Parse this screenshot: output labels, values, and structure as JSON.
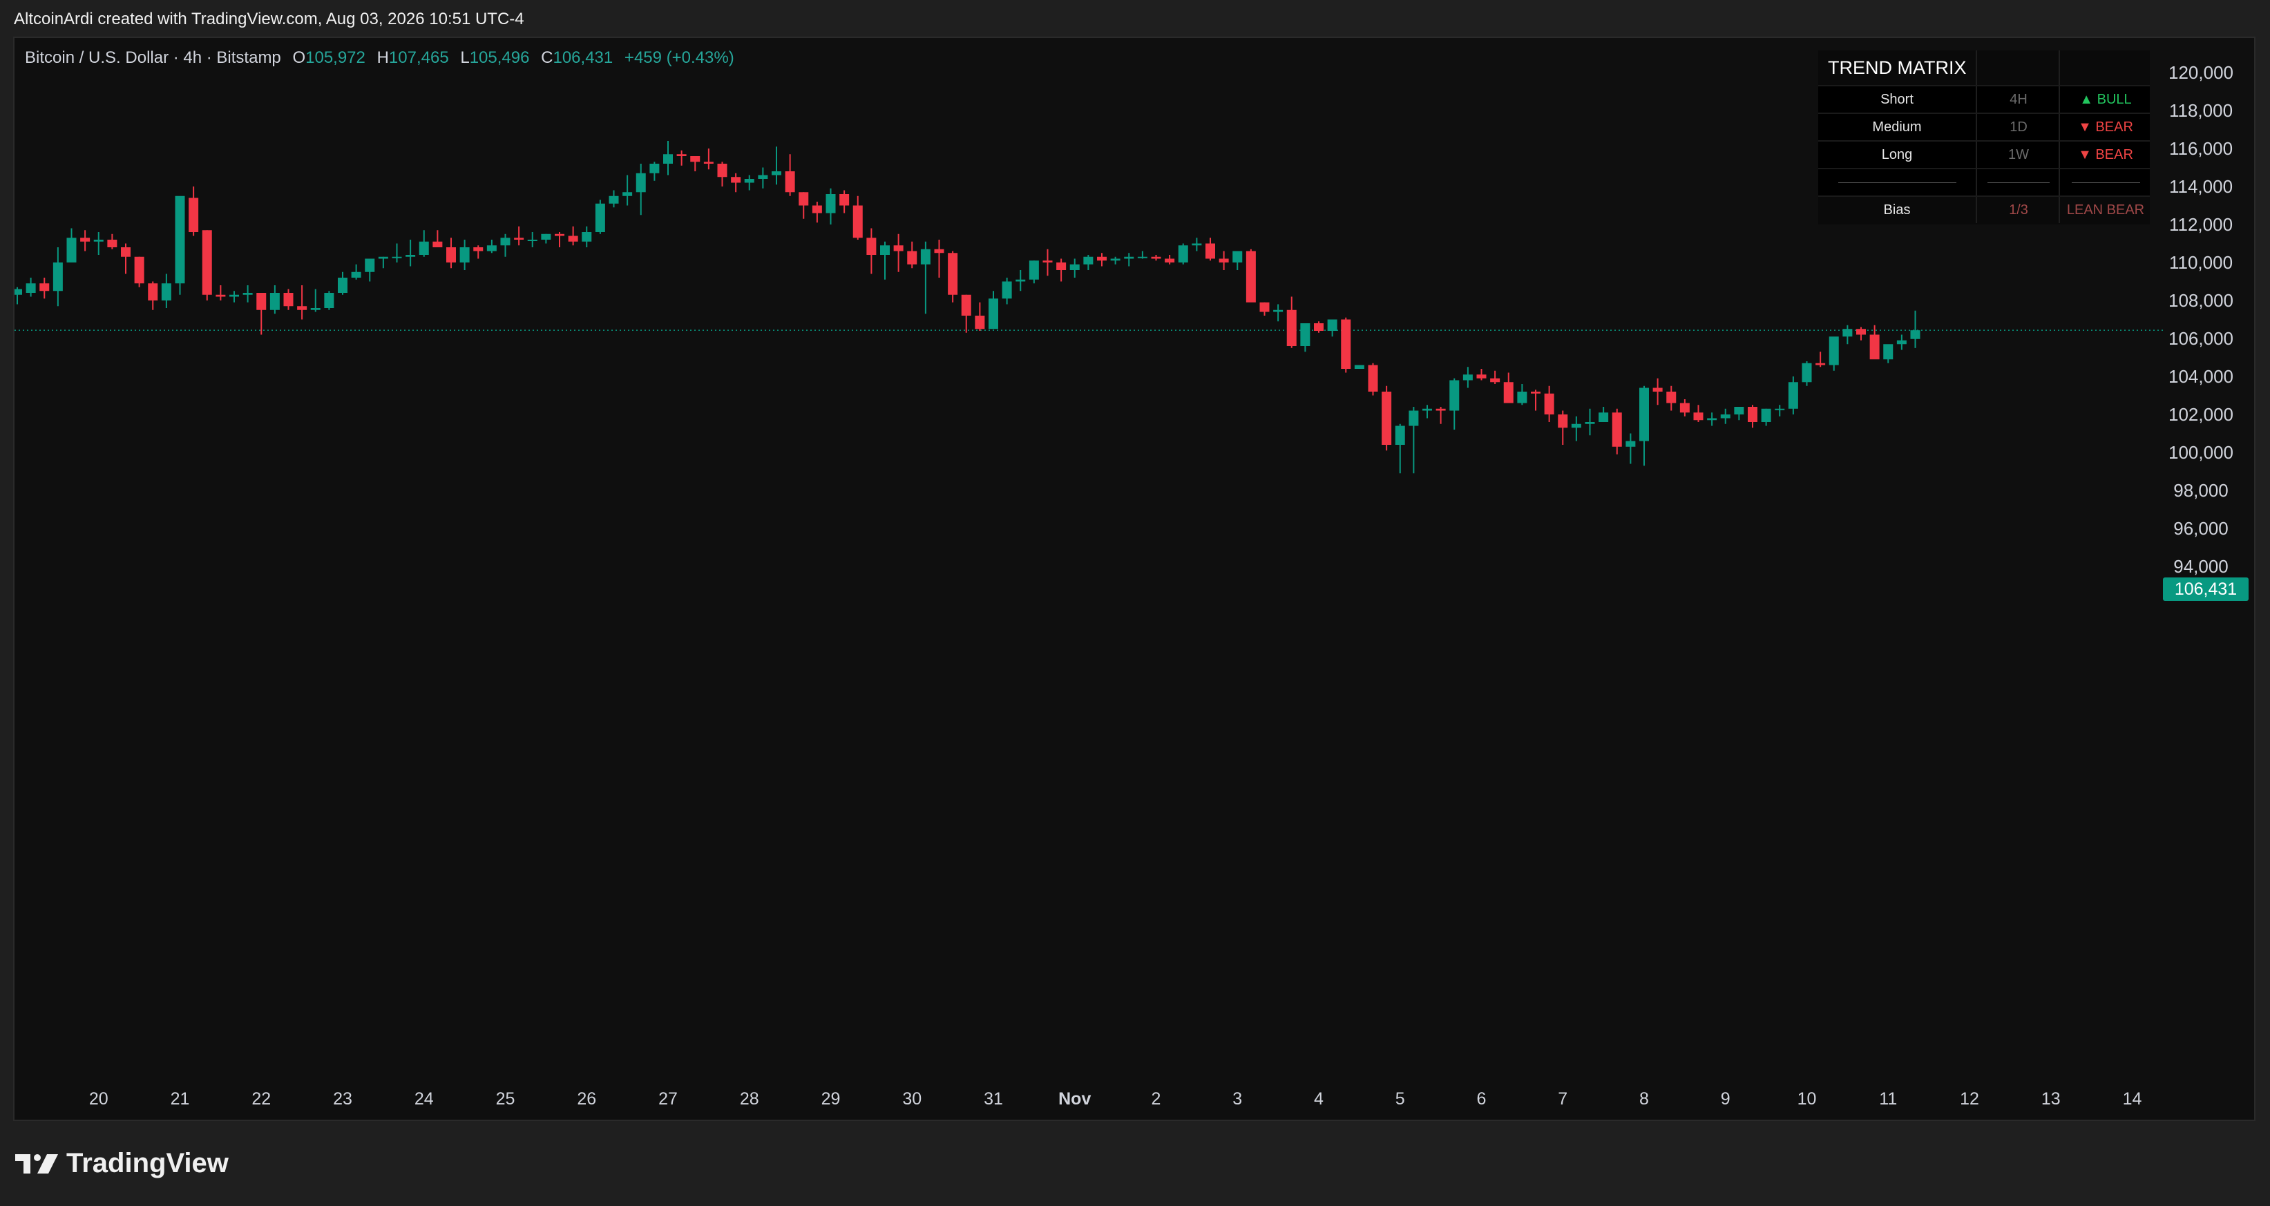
{
  "header": {
    "attribution": "AltcoinArdi created with TradingView.com, Aug 03, 2026 10:51 UTC-4"
  },
  "legend": {
    "symbol": "Bitcoin / U.S. Dollar · 4h · Bitstamp",
    "o_label": "O",
    "o_value": "105,972",
    "h_label": "H",
    "h_value": "107,465",
    "l_label": "L",
    "l_value": "105,496",
    "c_label": "C",
    "c_value": "106,431",
    "change": "+459 (+0.43%)"
  },
  "price_tag": "106,431",
  "trend_matrix": {
    "title": "TREND MATRIX",
    "rows": [
      {
        "label": "Short",
        "tf": "4H",
        "signal": "▲ BULL",
        "kind": "bull"
      },
      {
        "label": "Medium",
        "tf": "1D",
        "signal": "▼ BEAR",
        "kind": "bear"
      },
      {
        "label": "Long",
        "tf": "1W",
        "signal": "▼ BEAR",
        "kind": "bear"
      }
    ],
    "bias": {
      "label": "Bias",
      "score": "1/3",
      "value": "LEAN BEAR"
    }
  },
  "footer": {
    "brand": "TradingView"
  },
  "colors": {
    "up": "#089981",
    "down": "#f23645",
    "background": "#0f0f0f",
    "axis_text": "#d1d4dc",
    "bull": "#22c55e",
    "bear": "#ef4444"
  },
  "chart_data": {
    "type": "candlestick",
    "title": "",
    "xlabel": "",
    "ylabel": "",
    "ylim": [
      93000,
      121000
    ],
    "y_ticks": [
      94000,
      96000,
      98000,
      100000,
      102000,
      104000,
      106000,
      108000,
      110000,
      112000,
      114000,
      116000,
      118000,
      120000
    ],
    "y_tick_labels": [
      "94,000",
      "96,000",
      "98,000",
      "100,000",
      "102,000",
      "104,000",
      "106,000",
      "108,000",
      "110,000",
      "112,000",
      "114,000",
      "116,000",
      "118,000",
      "120,000"
    ],
    "x_ticks": [
      {
        "label": "20",
        "bar": 6
      },
      {
        "label": "21",
        "bar": 12
      },
      {
        "label": "22",
        "bar": 18
      },
      {
        "label": "23",
        "bar": 24
      },
      {
        "label": "24",
        "bar": 30
      },
      {
        "label": "25",
        "bar": 36
      },
      {
        "label": "26",
        "bar": 42
      },
      {
        "label": "27",
        "bar": 48
      },
      {
        "label": "28",
        "bar": 54
      },
      {
        "label": "29",
        "bar": 60
      },
      {
        "label": "30",
        "bar": 66
      },
      {
        "label": "31",
        "bar": 72
      },
      {
        "label": "Nov",
        "bar": 78,
        "bold": true
      },
      {
        "label": "2",
        "bar": 84
      },
      {
        "label": "3",
        "bar": 90
      },
      {
        "label": "4",
        "bar": 96
      },
      {
        "label": "5",
        "bar": 102
      },
      {
        "label": "6",
        "bar": 108
      },
      {
        "label": "7",
        "bar": 114
      },
      {
        "label": "8",
        "bar": 120
      },
      {
        "label": "9",
        "bar": 126
      },
      {
        "label": "10",
        "bar": 132
      },
      {
        "label": "11",
        "bar": 138
      },
      {
        "label": "12",
        "bar": 144
      },
      {
        "label": "13",
        "bar": 150
      },
      {
        "label": "14",
        "bar": 156
      }
    ],
    "bar_interval": "4h",
    "last_price": 106431,
    "ohlc": [
      [
        108300,
        108700,
        107800,
        108600
      ],
      [
        108400,
        109200,
        108200,
        108900
      ],
      [
        108900,
        109200,
        108100,
        108500
      ],
      [
        108500,
        110800,
        107700,
        110000
      ],
      [
        110000,
        111800,
        110000,
        111300
      ],
      [
        111300,
        111700,
        110600,
        111100
      ],
      [
        111100,
        111600,
        110400,
        111200
      ],
      [
        111200,
        111500,
        110700,
        110800
      ],
      [
        110800,
        111000,
        109400,
        110300
      ],
      [
        110300,
        110300,
        108700,
        108900
      ],
      [
        108900,
        109000,
        107500,
        108000
      ],
      [
        108000,
        109400,
        107600,
        108900
      ],
      [
        108900,
        113400,
        108300,
        113500
      ],
      [
        113400,
        114000,
        111400,
        111600
      ],
      [
        111700,
        111700,
        108000,
        108300
      ],
      [
        108300,
        108800,
        108000,
        108200
      ],
      [
        108200,
        108500,
        107900,
        108300
      ],
      [
        108300,
        108800,
        107900,
        108400
      ],
      [
        108400,
        108400,
        106200,
        107500
      ],
      [
        107500,
        108800,
        107300,
        108400
      ],
      [
        108400,
        108600,
        107500,
        107700
      ],
      [
        107700,
        108800,
        107000,
        107500
      ],
      [
        107500,
        108600,
        107400,
        107600
      ],
      [
        107600,
        108500,
        107500,
        108400
      ],
      [
        108400,
        109500,
        108300,
        109200
      ],
      [
        109200,
        109900,
        109100,
        109500
      ],
      [
        109500,
        110100,
        109000,
        110200
      ],
      [
        110200,
        110300,
        109700,
        110300
      ],
      [
        110300,
        111000,
        110000,
        110300
      ],
      [
        110300,
        111200,
        109800,
        110400
      ],
      [
        110400,
        111700,
        110300,
        111100
      ],
      [
        111100,
        111700,
        110900,
        110800
      ],
      [
        110800,
        111300,
        109700,
        110000
      ],
      [
        110000,
        111200,
        109600,
        110800
      ],
      [
        110800,
        110900,
        110200,
        110600
      ],
      [
        110600,
        111200,
        110500,
        110900
      ],
      [
        110900,
        111500,
        110300,
        111300
      ],
      [
        111300,
        111900,
        110900,
        111200
      ],
      [
        111200,
        111600,
        110800,
        111200
      ],
      [
        111200,
        111500,
        111000,
        111500
      ],
      [
        111500,
        111600,
        110800,
        111400
      ],
      [
        111400,
        111900,
        110900,
        111100
      ],
      [
        111100,
        111900,
        110800,
        111600
      ],
      [
        111600,
        113300,
        111500,
        113100
      ],
      [
        113100,
        113800,
        112900,
        113500
      ],
      [
        113500,
        114600,
        113000,
        113700
      ],
      [
        113700,
        115200,
        112500,
        114700
      ],
      [
        114700,
        115300,
        114300,
        115200
      ],
      [
        115200,
        116400,
        114600,
        115700
      ],
      [
        115700,
        115900,
        115100,
        115600
      ],
      [
        115600,
        115600,
        114800,
        115300
      ],
      [
        115300,
        116000,
        114900,
        115200
      ],
      [
        115200,
        115300,
        114000,
        114500
      ],
      [
        114500,
        114700,
        113700,
        114200
      ],
      [
        114200,
        114600,
        113800,
        114400
      ],
      [
        114400,
        115000,
        113900,
        114600
      ],
      [
        114600,
        116100,
        114100,
        114800
      ],
      [
        114800,
        115700,
        113500,
        113700
      ],
      [
        113700,
        113700,
        112300,
        113000
      ],
      [
        113000,
        113200,
        112100,
        112600
      ],
      [
        112600,
        113900,
        112000,
        113600
      ],
      [
        113600,
        113800,
        112600,
        113000
      ],
      [
        113000,
        113500,
        111200,
        111300
      ],
      [
        111300,
        111800,
        109400,
        110400
      ],
      [
        110400,
        111100,
        109100,
        110900
      ],
      [
        110900,
        111500,
        109500,
        110600
      ],
      [
        110600,
        111100,
        109700,
        109900
      ],
      [
        109900,
        111100,
        107300,
        110700
      ],
      [
        110700,
        111200,
        109200,
        110500
      ],
      [
        110500,
        110600,
        107900,
        108300
      ],
      [
        108300,
        108300,
        106300,
        107200
      ],
      [
        107200,
        107900,
        106400,
        106500
      ],
      [
        106500,
        108500,
        106500,
        108100
      ],
      [
        108100,
        109200,
        107800,
        109000
      ],
      [
        109000,
        109600,
        108500,
        109100
      ],
      [
        109100,
        110100,
        108900,
        110100
      ],
      [
        110100,
        110700,
        109300,
        110000
      ],
      [
        110000,
        110200,
        109000,
        109600
      ],
      [
        109600,
        110200,
        109200,
        109900
      ],
      [
        109900,
        110400,
        109600,
        110300
      ],
      [
        110300,
        110500,
        109800,
        110100
      ],
      [
        110100,
        110300,
        109900,
        110200
      ],
      [
        110200,
        110500,
        109800,
        110300
      ],
      [
        110300,
        110600,
        110200,
        110300
      ],
      [
        110300,
        110400,
        110100,
        110200
      ],
      [
        110200,
        110400,
        109900,
        110000
      ],
      [
        110000,
        111000,
        109900,
        110900
      ],
      [
        110900,
        111300,
        110600,
        111000
      ],
      [
        111000,
        111300,
        110100,
        110200
      ],
      [
        110200,
        110600,
        109600,
        110000
      ],
      [
        110000,
        110600,
        109600,
        110600
      ],
      [
        110600,
        110700,
        108200,
        107900
      ],
      [
        107900,
        107900,
        107200,
        107400
      ],
      [
        107400,
        107800,
        106900,
        107500
      ],
      [
        107500,
        108200,
        105500,
        105600
      ],
      [
        105600,
        106500,
        105300,
        106800
      ],
      [
        106800,
        106900,
        106300,
        106400
      ],
      [
        106400,
        107000,
        106100,
        107000
      ],
      [
        107000,
        107100,
        104200,
        104400
      ],
      [
        104400,
        104600,
        104400,
        104600
      ],
      [
        104600,
        104700,
        103000,
        103200
      ],
      [
        103200,
        103500,
        100100,
        100400
      ],
      [
        100400,
        101500,
        98900,
        101400
      ],
      [
        101400,
        102400,
        98900,
        102200
      ],
      [
        102200,
        102500,
        101800,
        102300
      ],
      [
        102300,
        102400,
        101500,
        102200
      ],
      [
        102200,
        103900,
        101200,
        103800
      ],
      [
        103800,
        104500,
        103400,
        104100
      ],
      [
        104100,
        104400,
        103800,
        103900
      ],
      [
        103900,
        104300,
        103600,
        103700
      ],
      [
        103700,
        104200,
        102700,
        102600
      ],
      [
        102600,
        103600,
        102500,
        103200
      ],
      [
        103200,
        103300,
        102200,
        103100
      ],
      [
        103100,
        103500,
        101600,
        102000
      ],
      [
        102000,
        102200,
        100400,
        101300
      ],
      [
        101300,
        101900,
        100600,
        101500
      ],
      [
        101500,
        102300,
        100900,
        101600
      ],
      [
        101600,
        102400,
        101600,
        102100
      ],
      [
        102100,
        102300,
        99900,
        100300
      ],
      [
        100300,
        101000,
        99400,
        100600
      ],
      [
        100600,
        103500,
        99300,
        103400
      ],
      [
        103400,
        103900,
        102500,
        103200
      ],
      [
        103200,
        103500,
        102200,
        102600
      ],
      [
        102600,
        102800,
        101900,
        102100
      ],
      [
        102100,
        102500,
        101600,
        101700
      ],
      [
        101700,
        102100,
        101400,
        101800
      ],
      [
        101800,
        102300,
        101500,
        102000
      ],
      [
        102000,
        102300,
        101700,
        102400
      ],
      [
        102400,
        102500,
        101300,
        101600
      ],
      [
        101600,
        102300,
        101400,
        102300
      ],
      [
        102300,
        102500,
        101900,
        102300
      ],
      [
        102300,
        104000,
        102000,
        103700
      ],
      [
        103700,
        104800,
        103500,
        104700
      ],
      [
        104700,
        105300,
        104500,
        104600
      ],
      [
        104600,
        105900,
        104300,
        106100
      ],
      [
        106100,
        106700,
        105700,
        106500
      ],
      [
        106500,
        106600,
        105900,
        106200
      ],
      [
        106200,
        106700,
        105400,
        104900
      ],
      [
        104900,
        105600,
        104700,
        105700
      ],
      [
        105700,
        106200,
        105400,
        105900
      ],
      [
        105972,
        107465,
        105496,
        106431
      ]
    ]
  }
}
